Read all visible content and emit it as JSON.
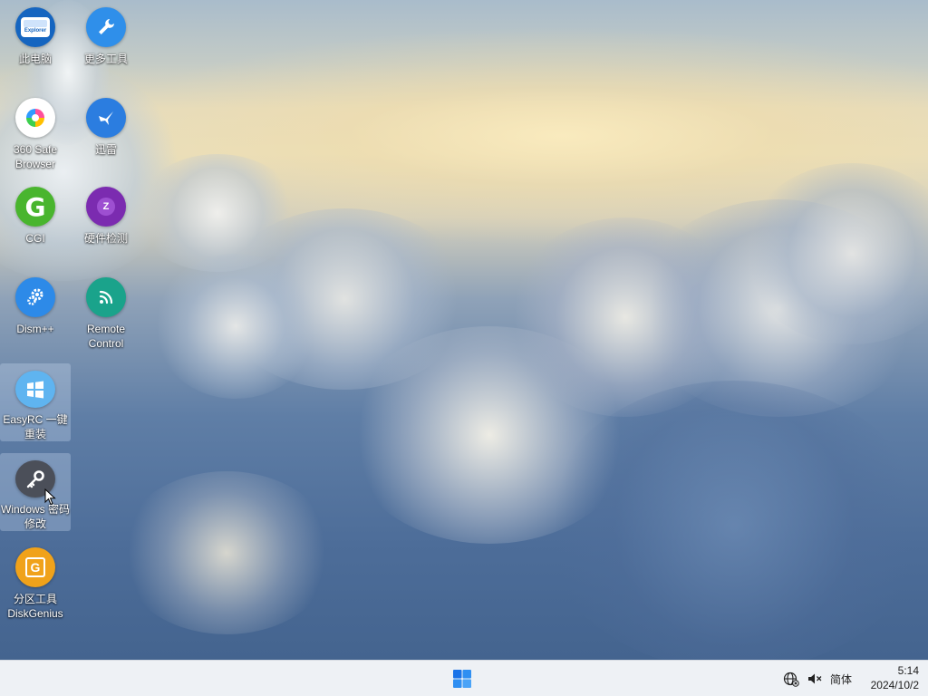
{
  "desktop_icons": [
    {
      "label": "此电脑",
      "badge": "Explorer",
      "icon": "this-pc-icon",
      "color": "#1565c0"
    },
    {
      "label": "更多工具",
      "icon": "wrench-icon",
      "color": "#2f8fea"
    },
    {
      "label": "360 Safe Browser",
      "icon": "360-browser-icon",
      "color": "#ffffff"
    },
    {
      "label": "迅雷",
      "icon": "xunlei-bird-icon",
      "color": "#2b7de0"
    },
    {
      "label": "CGI",
      "badge": "G",
      "icon": "cgi-icon",
      "color": "#49b52e"
    },
    {
      "label": "硬件检测",
      "badge": "Z",
      "icon": "hardware-check-icon",
      "color": "#7b2bb0"
    },
    {
      "label": "Dism++",
      "icon": "gears-icon",
      "color": "#2d8ae8"
    },
    {
      "label": "Remote Control",
      "icon": "remote-control-icon",
      "color": "#1aa38b"
    },
    {
      "label": "EasyRC 一键重装",
      "icon": "easyrc-windows-icon",
      "color": "#5fb4f0"
    },
    {
      "label": "Windows 密码修改",
      "icon": "key-icon",
      "color": "#4b4f59"
    },
    {
      "label": "分区工具 DiskGenius",
      "badge": "G",
      "icon": "diskgenius-icon",
      "color": "#f0a21a"
    }
  ],
  "taskbar": {
    "ime_label": "简体",
    "time": "5:14",
    "date": "2024/10/2",
    "accent": "#1a73e8"
  }
}
